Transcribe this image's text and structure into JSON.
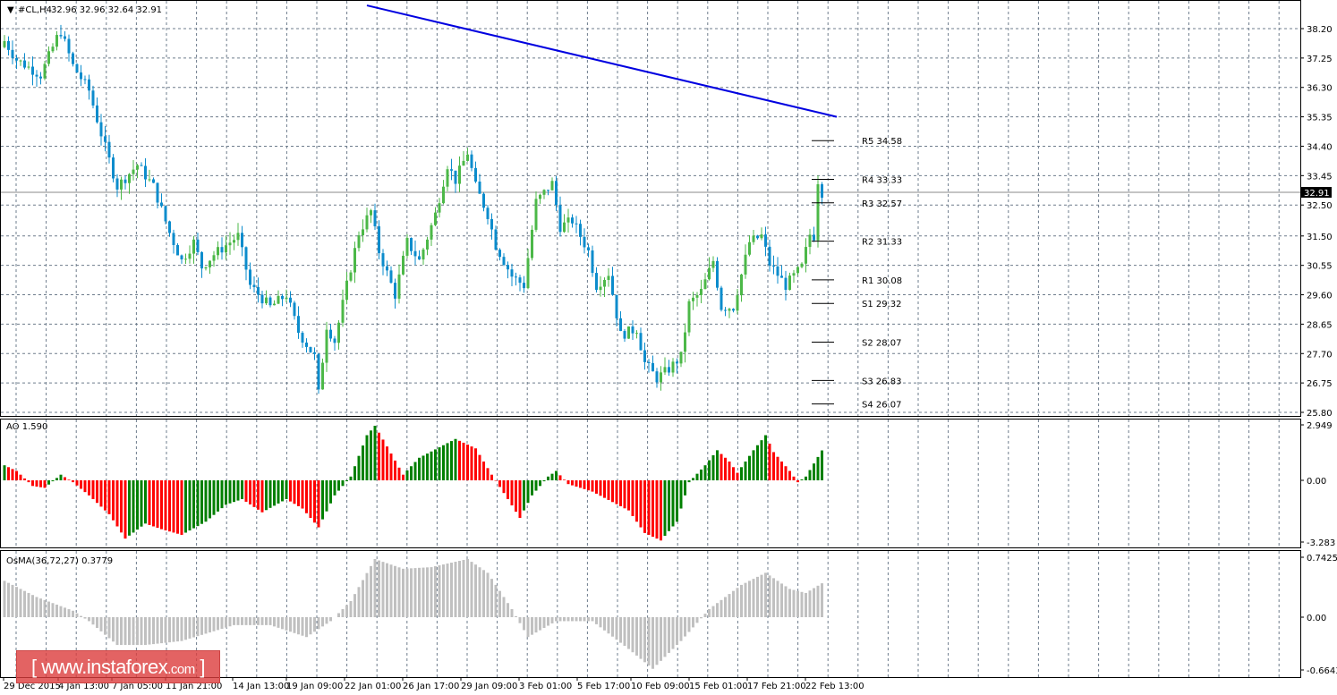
{
  "header": {
    "symbol": "#CL,H4",
    "ohlc": "32.96 32.96 32.64 32.91"
  },
  "colors": {
    "bull": "#4cb848",
    "bear": "#0c8ccc",
    "ao_up": "#008000",
    "ao_down": "#ff0000",
    "osma": "#c0c0c0",
    "trendline": "#0000e0",
    "grid": "#6e7c8c"
  },
  "main": {
    "price_ticks": [
      "38.20",
      "37.25",
      "36.30",
      "35.35",
      "34.40",
      "33.45",
      "32.50",
      "31.50",
      "30.55",
      "29.60",
      "28.65",
      "27.70",
      "26.75",
      "25.80"
    ],
    "price_range": [
      25.75,
      38.95
    ],
    "current_price": "32.91",
    "pivots": [
      {
        "label": "R5 34.58",
        "value": 34.58
      },
      {
        "label": "R4 33.33",
        "value": 33.33
      },
      {
        "label": "R3 32.57",
        "value": 32.57
      },
      {
        "label": "R2 31.33",
        "value": 31.33
      },
      {
        "label": "R1 30.08",
        "value": 30.08
      },
      {
        "label": "S1 29.32",
        "value": 29.32
      },
      {
        "label": "S2 28.07",
        "value": 28.07
      },
      {
        "label": "S3 26.83",
        "value": 26.83
      },
      {
        "label": "S4 26.07",
        "value": 26.07
      }
    ],
    "price_path": [
      [
        0,
        37.8
      ],
      [
        3,
        37.2
      ],
      [
        9,
        36.7
      ],
      [
        13,
        37.9
      ],
      [
        14,
        38.1
      ],
      [
        17,
        37.0
      ],
      [
        21,
        36.2
      ],
      [
        24,
        34.8
      ],
      [
        28,
        33.1
      ],
      [
        33,
        33.8
      ],
      [
        37,
        33.1
      ],
      [
        41,
        31.6
      ],
      [
        44,
        30.7
      ],
      [
        47,
        31.3
      ],
      [
        49,
        30.5
      ],
      [
        52,
        30.9
      ],
      [
        58,
        31.5
      ],
      [
        61,
        29.9
      ],
      [
        66,
        29.2
      ],
      [
        70,
        29.6
      ],
      [
        73,
        28.4
      ],
      [
        77,
        27.6
      ],
      [
        78,
        26.4
      ],
      [
        80,
        28.6
      ],
      [
        82,
        28.1
      ],
      [
        85,
        29.9
      ],
      [
        88,
        31.6
      ],
      [
        91,
        32.3
      ],
      [
        93,
        31.0
      ],
      [
        97,
        29.6
      ],
      [
        100,
        31.3
      ],
      [
        103,
        30.7
      ],
      [
        107,
        32.2
      ],
      [
        110,
        33.8
      ],
      [
        112,
        33.3
      ],
      [
        115,
        34.2
      ],
      [
        117,
        33.1
      ],
      [
        120,
        32.2
      ],
      [
        122,
        31.2
      ],
      [
        126,
        30.2
      ],
      [
        129,
        29.9
      ],
      [
        132,
        32.6
      ],
      [
        136,
        33.2
      ],
      [
        138,
        31.8
      ],
      [
        141,
        32.0
      ],
      [
        145,
        31.0
      ],
      [
        147,
        29.9
      ],
      [
        150,
        30.3
      ],
      [
        153,
        28.3
      ],
      [
        157,
        28.5
      ],
      [
        159,
        27.4
      ],
      [
        162,
        26.9
      ],
      [
        165,
        27.2
      ],
      [
        168,
        27.6
      ],
      [
        170,
        29.3
      ],
      [
        173,
        29.7
      ],
      [
        176,
        30.7
      ],
      [
        178,
        29.2
      ],
      [
        181,
        29.2
      ],
      [
        185,
        31.3
      ],
      [
        188,
        31.5
      ],
      [
        190,
        30.6
      ],
      [
        194,
        29.9
      ],
      [
        198,
        30.5
      ],
      [
        200,
        31.55
      ],
      [
        201,
        31.5
      ],
      [
        202,
        33.3
      ],
      [
        203,
        32.91
      ]
    ],
    "trendline": {
      "from": [
        "22 Jan 01:00",
        38.95
      ],
      "to": [
        "22 Feb 13:00",
        35.35
      ]
    }
  },
  "ao": {
    "label": "AO 1.590",
    "ticks": [
      "2.949",
      "0.00",
      "-3.283"
    ],
    "range": [
      -3.283,
      2.949
    ],
    "path": [
      [
        0,
        0.8
      ],
      [
        3,
        0.5
      ],
      [
        7,
        -0.3
      ],
      [
        10,
        -0.4
      ],
      [
        14,
        0.3
      ],
      [
        17,
        -0.1
      ],
      [
        21,
        -0.8
      ],
      [
        26,
        -1.8
      ],
      [
        30,
        -3.1
      ],
      [
        35,
        -2.3
      ],
      [
        39,
        -2.6
      ],
      [
        44,
        -2.9
      ],
      [
        50,
        -2.2
      ],
      [
        55,
        -1.3
      ],
      [
        59,
        -1.0
      ],
      [
        64,
        -1.7
      ],
      [
        70,
        -1.0
      ],
      [
        74,
        -1.5
      ],
      [
        78,
        -2.5
      ],
      [
        82,
        -0.8
      ],
      [
        86,
        0.2
      ],
      [
        90,
        2.4
      ],
      [
        92,
        2.9
      ],
      [
        95,
        1.8
      ],
      [
        99,
        0.3
      ],
      [
        103,
        1.2
      ],
      [
        112,
        2.2
      ],
      [
        117,
        1.7
      ],
      [
        121,
        0.3
      ],
      [
        125,
        -1.0
      ],
      [
        128,
        -2.0
      ],
      [
        131,
        -0.8
      ],
      [
        135,
        0.2
      ],
      [
        137,
        0.5
      ],
      [
        140,
        -0.2
      ],
      [
        146,
        -0.6
      ],
      [
        155,
        -1.6
      ],
      [
        159,
        -2.8
      ],
      [
        163,
        -3.2
      ],
      [
        167,
        -2.2
      ],
      [
        170,
        -0.1
      ],
      [
        174,
        0.8
      ],
      [
        177,
        1.6
      ],
      [
        180,
        1.0
      ],
      [
        182,
        0.4
      ],
      [
        186,
        1.6
      ],
      [
        189,
        2.4
      ],
      [
        191,
        1.5
      ],
      [
        195,
        0.5
      ],
      [
        197,
        -0.1
      ],
      [
        199,
        0.2
      ],
      [
        203,
        1.59
      ]
    ]
  },
  "osma": {
    "label": "OsMA(36,72,27) 0.3779",
    "ticks": [
      "0.7425",
      "0.00",
      "-0.6643"
    ],
    "range": [
      -0.6643,
      0.7425
    ],
    "path": [
      [
        0,
        0.45
      ],
      [
        8,
        0.25
      ],
      [
        17,
        0.08
      ],
      [
        21,
        -0.05
      ],
      [
        28,
        -0.35
      ],
      [
        35,
        -0.35
      ],
      [
        44,
        -0.3
      ],
      [
        57,
        -0.1
      ],
      [
        66,
        -0.1
      ],
      [
        75,
        -0.25
      ],
      [
        81,
        -0.05
      ],
      [
        86,
        0.2
      ],
      [
        92,
        0.72
      ],
      [
        99,
        0.6
      ],
      [
        106,
        0.62
      ],
      [
        115,
        0.72
      ],
      [
        120,
        0.55
      ],
      [
        126,
        0.1
      ],
      [
        130,
        -0.25
      ],
      [
        137,
        -0.05
      ],
      [
        146,
        -0.05
      ],
      [
        155,
        -0.4
      ],
      [
        161,
        -0.65
      ],
      [
        168,
        -0.3
      ],
      [
        175,
        0.1
      ],
      [
        183,
        0.4
      ],
      [
        189,
        0.55
      ],
      [
        195,
        0.35
      ],
      [
        199,
        0.3
      ],
      [
        203,
        0.42
      ]
    ]
  },
  "time_axis": [
    "29 Dec 2015",
    "4 Jan 13:00",
    "7 Jan 05:00",
    "11 Jan 21:00",
    "14 Jan 13:00",
    "19 Jan 09:00",
    "22 Jan 01:00",
    "26 Jan 17:00",
    "29 Jan 09:00",
    "3 Feb 01:00",
    "5 Feb 17:00",
    "10 Feb 09:00",
    "15 Feb 01:00",
    "17 Feb 21:00",
    "22 Feb 13:00"
  ],
  "watermark": {
    "bracket_open": "[",
    "site": "www.instaforex",
    "tld": ".com",
    "bracket_close": "]"
  }
}
